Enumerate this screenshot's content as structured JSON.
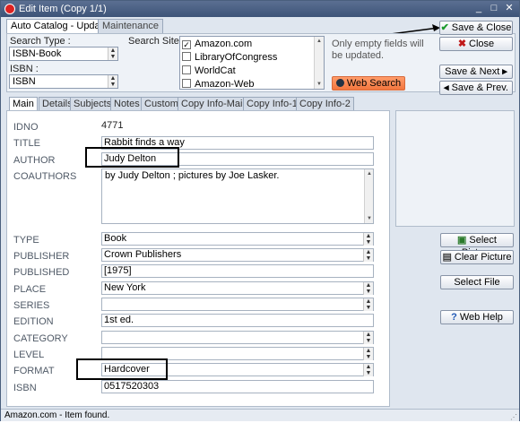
{
  "window": {
    "title": "Edit Item (Copy 1/1)",
    "minimize": "_",
    "maximize": "□",
    "close": "✕"
  },
  "top_tabs": [
    {
      "label": "Auto Catalog - Update",
      "active": true
    },
    {
      "label": "Maintenance",
      "active": false
    }
  ],
  "search": {
    "type_label": "Search Type :",
    "type_value": "ISBN-Book",
    "isbn_label": "ISBN :",
    "isbn_value": "ISBN",
    "site_label": "Search Site :",
    "sites": [
      {
        "name": "Amazon.com",
        "checked": true
      },
      {
        "name": "LibraryOfCongress",
        "checked": false
      },
      {
        "name": "WorldCat",
        "checked": false
      },
      {
        "name": "Amazon-Web",
        "checked": false
      }
    ],
    "note": "Only empty fields will be updated.",
    "web_search_label": "Web Search"
  },
  "actions": {
    "save_close": "Save & Close",
    "close": "Close",
    "save_next": "Save & Next",
    "save_prev": "Save & Prev."
  },
  "sub_tabs": [
    "Main",
    "Details",
    "Subjects",
    "Notes",
    "Custom",
    "Copy Info-Main",
    "Copy Info-1",
    "Copy Info-2"
  ],
  "fields": {
    "idno_label": "IDNO",
    "idno": "4771",
    "title_label": "TITLE",
    "title": "Rabbit finds a way",
    "author_label": "AUTHOR",
    "author": "Judy Delton",
    "coauthors_label": "COAUTHORS",
    "coauthors": "by Judy Delton ; pictures by Joe Lasker.",
    "type_label": "TYPE",
    "type": "Book",
    "publisher_label": "PUBLISHER",
    "publisher": "Crown Publishers",
    "published_label": "PUBLISHED",
    "published": "[1975]",
    "place_label": "PLACE",
    "place": "New York",
    "series_label": "SERIES",
    "series": "",
    "edition_label": "EDITION",
    "edition": "1st ed.",
    "category_label": "CATEGORY",
    "category": "",
    "level_label": "LEVEL",
    "level": "",
    "format_label": "FORMAT",
    "format": "Hardcover",
    "isbn_label": "ISBN",
    "isbn": "0517520303"
  },
  "side_buttons": {
    "select_picture": "Select Picture",
    "clear_picture": "Clear Picture",
    "select_file": "Select File",
    "web_help": "Web Help"
  },
  "status": "Amazon.com - Item found.",
  "colors": {
    "titlebar": "#3d5478",
    "accent_orange": "#f3763e",
    "window_bg": "#dfe6ef"
  }
}
